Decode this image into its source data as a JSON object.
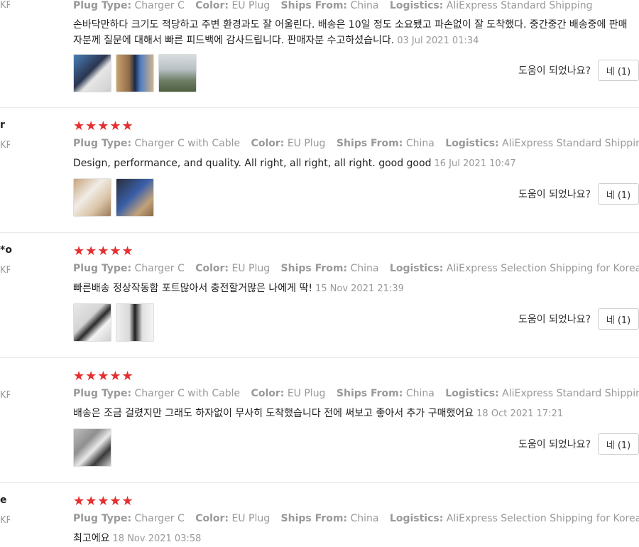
{
  "helpful_question": "도움이 되었나요?",
  "reviews": [
    {
      "user": "",
      "country": "KR",
      "stars": "★★★★★",
      "plug": "Charger C",
      "color": "EU Plug",
      "ships": "China",
      "logistics": "AliExpress Standard Shipping",
      "text": "손바닥만하다 크기도 적당하고 주변 환경과도 잘 어울린다. 배송은 10일 정도 소요됐고 파손없이 잘 도착했다. 중간중간 배송중에 판매자분께 질문에 대해서 빠른 피드백에 감사드립니다. 판매자분 수고하셨습니다.",
      "date": "03 Jul 2021 01:34",
      "helpful": "네 (1)"
    },
    {
      "user": "r",
      "country": "KR",
      "stars": "★★★★★",
      "plug": "Charger C with Cable",
      "color": "EU Plug",
      "ships": "China",
      "logistics": "AliExpress Standard Shipping",
      "text": "Design, performance, and quality. All right, all right, all right. good good",
      "date": "16 Jul 2021 10:47",
      "helpful": "네 (1)"
    },
    {
      "user": "*o",
      "country": "KR",
      "stars": "★★★★★",
      "plug": "Charger C",
      "color": "EU Plug",
      "ships": "China",
      "logistics": "AliExpress Selection Shipping for Korea",
      "text": "빠른배송 정상작동함 포트많아서 충전할거많은 나에게 딱!",
      "date": "15 Nov 2021 21:39",
      "helpful": "네 (1)"
    },
    {
      "user": "",
      "country": "KR",
      "stars": "★★★★★",
      "plug": "Charger C with Cable",
      "color": "EU Plug",
      "ships": "China",
      "logistics": "AliExpress Standard Shipping",
      "text": "배송은 조금 걸렸지만 그래도 하자없이 무사히 도착했습니다 전에 써보고 좋아서 추가 구매했어요",
      "date": "18 Oct 2021 17:21",
      "helpful": "네 (1)"
    },
    {
      "user": "e",
      "country": "KR",
      "stars": "★★★★★",
      "plug": "Charger C",
      "color": "EU Plug",
      "ships": "China",
      "logistics": "AliExpress Selection Shipping for Korea",
      "text": "최고에요",
      "date": "18 Nov 2021 03:58"
    }
  ],
  "labels": {
    "plug": "Plug Type:",
    "color": "Color:",
    "ships": "Ships From:",
    "logistics": "Logistics:"
  }
}
